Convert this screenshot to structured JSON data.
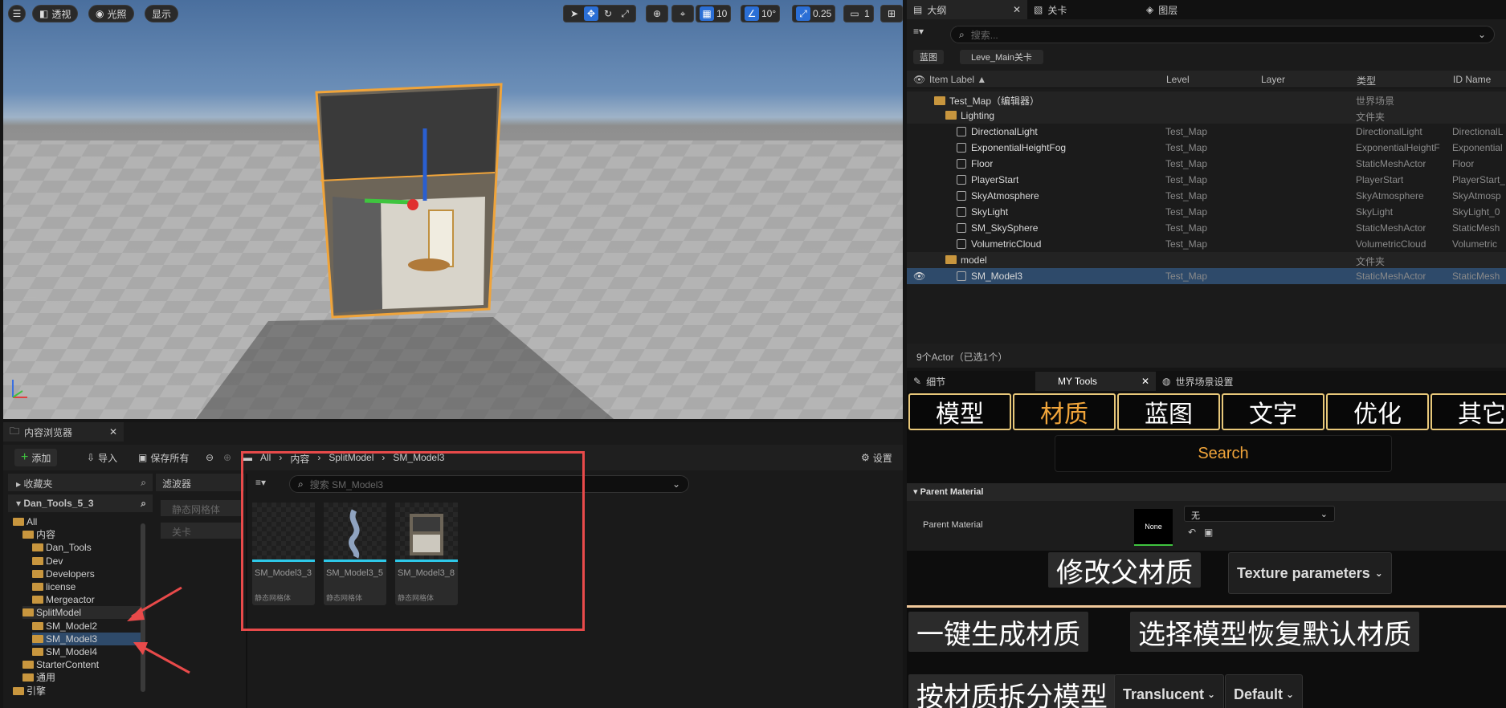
{
  "viewport": {
    "perspective": "透视",
    "lighting": "光照",
    "show": "显示",
    "grid": "10",
    "angle": "10°",
    "scale": "0.25",
    "camera": "1"
  },
  "outliner": {
    "tabs": [
      "大纲",
      "关卡",
      "图层"
    ],
    "search_placeholder": "搜索...",
    "filter_chips": [
      "蓝图",
      "Leve_Main关卡"
    ],
    "columns": [
      "Item Label ▲",
      "Level",
      "Layer",
      "类型",
      "ID Name"
    ],
    "rows": [
      {
        "label": "Test_Map（编辑器）",
        "level": "",
        "type": "世界场景",
        "id": "",
        "kind": "world"
      },
      {
        "label": "Lighting",
        "level": "",
        "type": "文件夹",
        "id": "",
        "kind": "folder"
      },
      {
        "label": "DirectionalLight",
        "level": "Test_Map",
        "type": "DirectionalLight",
        "id": "DirectionalL",
        "kind": "actor"
      },
      {
        "label": "ExponentialHeightFog",
        "level": "Test_Map",
        "type": "ExponentialHeightF",
        "id": "Exponential",
        "kind": "actor"
      },
      {
        "label": "Floor",
        "level": "Test_Map",
        "type": "StaticMeshActor",
        "id": "Floor",
        "kind": "actor"
      },
      {
        "label": "PlayerStart",
        "level": "Test_Map",
        "type": "PlayerStart",
        "id": "PlayerStart_",
        "kind": "actor"
      },
      {
        "label": "SkyAtmosphere",
        "level": "Test_Map",
        "type": "SkyAtmosphere",
        "id": "SkyAtmosp",
        "kind": "actor"
      },
      {
        "label": "SkyLight",
        "level": "Test_Map",
        "type": "SkyLight",
        "id": "SkyLight_0",
        "kind": "actor"
      },
      {
        "label": "SM_SkySphere",
        "level": "Test_Map",
        "type": "StaticMeshActor",
        "id": "StaticMesh",
        "kind": "actor"
      },
      {
        "label": "VolumetricCloud",
        "level": "Test_Map",
        "type": "VolumetricCloud",
        "id": "Volumetric",
        "kind": "actor"
      },
      {
        "label": "model",
        "level": "",
        "type": "文件夹",
        "id": "",
        "kind": "folder"
      },
      {
        "label": "SM_Model3",
        "level": "Test_Map",
        "type": "StaticMeshActor",
        "id": "StaticMesh",
        "kind": "actor"
      }
    ],
    "footer": "9个Actor（已选1个）"
  },
  "cb": {
    "tab": "内容浏览器",
    "add": "添加",
    "import": "导入",
    "save_all": "保存所有",
    "settings": "设置",
    "breadcrumb": [
      "All",
      "内容",
      "SplitModel",
      "SM_Model3"
    ],
    "favorites": "收藏夹",
    "project": "Dan_Tools_5_3",
    "filters": "滤波器",
    "filter_items": [
      "静态网格体",
      "关卡"
    ],
    "search_placeholder": "搜索 SM_Model3",
    "tree": [
      "All",
      "内容",
      "Dan_Tools",
      "Dev",
      "Developers",
      "license",
      "Mergeactor",
      "SplitModel",
      "SM_Model2",
      "SM_Model3",
      "SM_Model4",
      "StarterContent",
      "通用",
      "引擎"
    ],
    "assets": [
      {
        "name": "SM_Model3_3",
        "type": "静态网格体"
      },
      {
        "name": "SM_Model3_5",
        "type": "静态网格体"
      },
      {
        "name": "SM_Model3_8",
        "type": "静态网格体"
      }
    ]
  },
  "tools": {
    "tabs": [
      "细节",
      "MY Tools",
      "世界场景设置"
    ],
    "bigtabs": [
      "模型",
      "材质",
      "蓝图",
      "文字",
      "优化",
      "其它"
    ],
    "search": "Search",
    "section": "Parent Material",
    "param_label": "Parent Material",
    "none_thumb": "None",
    "select_value": "无",
    "btn_modify_parent": "修改父材质",
    "texture_params": "Texture parameters",
    "btn_gen": "一键生成材质",
    "btn_restore": "选择模型恢复默认材质",
    "btn_split": "按材质拆分模型",
    "translucent": "Translucent",
    "default": "Default"
  },
  "colors": {
    "accent_orange": "#f0a43a",
    "selection": "#2e4a6a",
    "highlight_red": "#e84a4a",
    "cyan": "#2ec8e8"
  }
}
